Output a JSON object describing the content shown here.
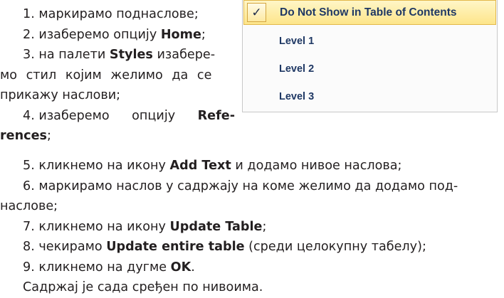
{
  "text_block_top": [
    {
      "num": "1.",
      "parts": [
        {
          "t": "маркирамо поднаслове;",
          "b": false
        }
      ]
    },
    {
      "num": "2.",
      "parts": [
        {
          "t": "изаберемо опцију ",
          "b": false
        },
        {
          "t": "Home",
          "b": true
        },
        {
          "t": ";",
          "b": false
        }
      ]
    },
    {
      "num": "3.",
      "line1": [
        {
          "t": "на палети ",
          "b": false
        },
        {
          "t": "Styles",
          "b": true
        },
        {
          "t": " изабере-",
          "b": false
        }
      ],
      "line2": "мо стил којим желимо да се",
      "line3": "прикажу наслови;"
    },
    {
      "num": "4.",
      "line1": [
        "изаберемо",
        "опцију"
      ],
      "line1_bold": "Refe-",
      "line2_bold": "rences",
      "line2_rest": ";"
    }
  ],
  "text_block_bottom": [
    {
      "num": "5.",
      "parts": [
        {
          "t": "кликнемо на икону ",
          "b": false
        },
        {
          "t": "Add Text",
          "b": true
        },
        {
          "t": " и додамо нивое наслова;",
          "b": false
        }
      ]
    },
    {
      "num": "6.",
      "line1": "маркирамо наслов у садржају на коме желимо да додамо под-",
      "line2": "наслове;"
    },
    {
      "num": "7.",
      "parts": [
        {
          "t": "кликнемо на икону ",
          "b": false
        },
        {
          "t": "Update Table",
          "b": true
        },
        {
          "t": ";",
          "b": false
        }
      ]
    },
    {
      "num": "8.",
      "parts": [
        {
          "t": "чекирамо ",
          "b": false
        },
        {
          "t": "Update entire table",
          "b": true
        },
        {
          "t": " (среди целокупну табелу);",
          "b": false
        }
      ]
    },
    {
      "num": "9.",
      "parts": [
        {
          "t": "кликнемо на дугме ",
          "b": false
        },
        {
          "t": "OK",
          "b": true
        },
        {
          "t": ".",
          "b": false
        }
      ]
    }
  ],
  "closing": "Садржај је сада сређен по нивоима.",
  "menu": {
    "check_glyph": "✓",
    "selected_label": "Do Not Show in Table of Contents",
    "levels": [
      "Level 1",
      "Level 2",
      "Level 3"
    ],
    "colors": {
      "highlight": "#fde58a",
      "text": "#1f3864"
    }
  }
}
